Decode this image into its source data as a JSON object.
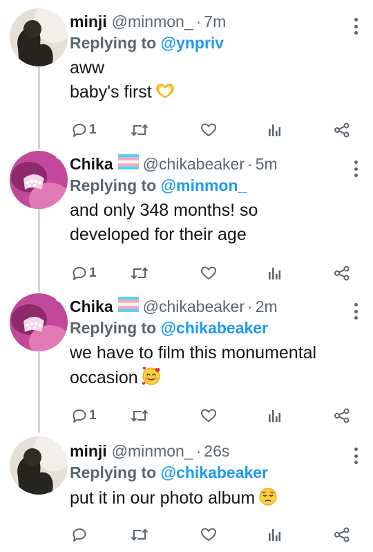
{
  "icons": {
    "more": "more-vertical-icon",
    "reply": "reply-icon",
    "retweet": "retweet-icon",
    "like": "like-icon",
    "analytics": "analytics-icon",
    "share": "share-icon",
    "flag": "trans-flag-emoji",
    "emoji_heart_hands": "heart-hands-emoji",
    "emoji_smiling_hearts": "smiling-face-with-hearts-emoji",
    "emoji_pensive": "pensive-face-emoji"
  },
  "colors": {
    "mention": "#1d9bf0",
    "muted": "#5b6670",
    "text": "#141414",
    "thread_line": "#d0d5da"
  },
  "tweets": [
    {
      "name": "minji",
      "handle": "@minmon_",
      "sep": "·",
      "time": "7m",
      "replying_prefix": "Replying to ",
      "replying_to": "@ynpriv",
      "lines": [
        "aww",
        "baby's first"
      ],
      "reply_count": "1"
    },
    {
      "name": "Chika",
      "handle": "@chikabeaker",
      "sep": "·",
      "time": "5m",
      "replying_prefix": "Replying to ",
      "replying_to": "@minmon_",
      "lines": [
        "and only 348 months! so",
        "developed for their age"
      ],
      "reply_count": "1"
    },
    {
      "name": "Chika",
      "handle": "@chikabeaker",
      "sep": "·",
      "time": "2m",
      "replying_prefix": "Replying to ",
      "replying_to": "@chikabeaker",
      "lines": [
        "we have to film this monumental",
        "occasion"
      ],
      "reply_count": "1"
    },
    {
      "name": "minji",
      "handle": "@minmon_",
      "sep": "·",
      "time": "26s",
      "replying_prefix": "Replying to ",
      "replying_to": "@chikabeaker",
      "lines": [
        "put it in our photo album"
      ],
      "reply_count": ""
    }
  ]
}
